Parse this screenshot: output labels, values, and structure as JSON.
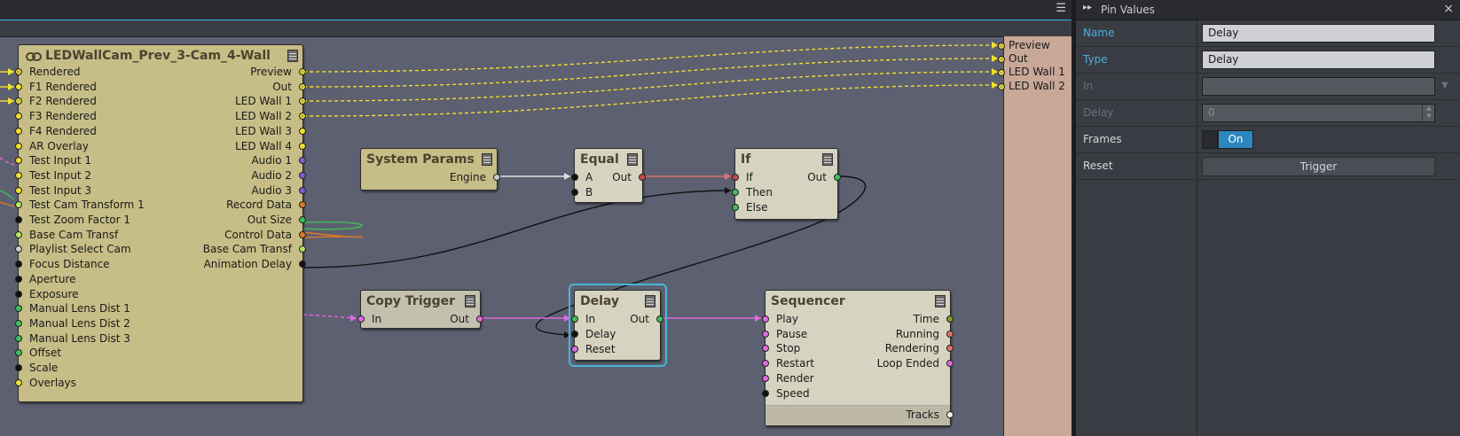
{
  "graph": {
    "nodes": {
      "ledwall": {
        "title": "LEDWallCam_Prev_3-Cam_4-Wall",
        "link_icon": "link-icon",
        "inputs": [
          "Rendered",
          "F1 Rendered",
          "F2 Rendered",
          "F3 Rendered",
          "F4 Rendered",
          "AR Overlay",
          "Test Input 1",
          "Test Input 2",
          "Test Input 3",
          "Test Cam Transform 1",
          "Test Zoom Factor 1",
          "Base Cam Transf",
          "Playlist Select Cam",
          "Focus Distance",
          "Aperture",
          "Exposure",
          "Manual Lens Dist 1",
          "Manual Lens Dist 2",
          "Manual Lens Dist 3",
          "Offset",
          "Scale",
          "Overlays"
        ],
        "outputs": [
          "Preview",
          "Out",
          "LED Wall 1",
          "LED Wall 2",
          "LED Wall 3",
          "LED Wall 4",
          "Audio 1",
          "Audio 2",
          "Audio 3",
          "Record Data",
          "Out Size",
          "Control Data",
          "Base Cam Transf",
          "Animation Delay"
        ]
      },
      "system_params": {
        "title": "System Params",
        "outputs": [
          "Engine"
        ]
      },
      "equal": {
        "title": "Equal",
        "inputs": [
          "A",
          "B"
        ],
        "outputs": [
          "Out"
        ]
      },
      "if": {
        "title": "If",
        "inputs": [
          "If",
          "Then",
          "Else"
        ],
        "outputs": [
          "Out"
        ]
      },
      "copy_trigger": {
        "title": "Copy Trigger",
        "inputs": [
          "In"
        ],
        "outputs": [
          "Out"
        ]
      },
      "delay": {
        "title": "Delay",
        "inputs": [
          "In",
          "Delay",
          "Reset"
        ],
        "outputs": [
          "Out"
        ]
      },
      "sequencer": {
        "title": "Sequencer",
        "inputs": [
          "Play",
          "Pause",
          "Stop",
          "Restart",
          "Render",
          "Speed"
        ],
        "outputs": [
          "Time",
          "Running",
          "Rendering",
          "Loop Ended"
        ],
        "footer_output": "Tracks"
      }
    },
    "graph_outputs": [
      "Preview",
      "Out",
      "LED Wall 1",
      "LED Wall 2"
    ],
    "colors": {
      "canvas": "#5d6070",
      "accent": "#3ab0e0",
      "node_tan": "#c7bd86",
      "node_light": "#d6d3c0",
      "output_strip": "#c9a898"
    }
  },
  "panel": {
    "title": "Pin Values",
    "rows": {
      "name": {
        "label": "Name",
        "value": "Delay"
      },
      "type": {
        "label": "Type",
        "value": "Delay"
      },
      "in": {
        "label": "In",
        "value": ""
      },
      "delay": {
        "label": "Delay",
        "value": "0"
      },
      "frames": {
        "label": "Frames",
        "toggle": "On"
      },
      "reset": {
        "label": "Reset",
        "button": "Trigger"
      }
    }
  }
}
